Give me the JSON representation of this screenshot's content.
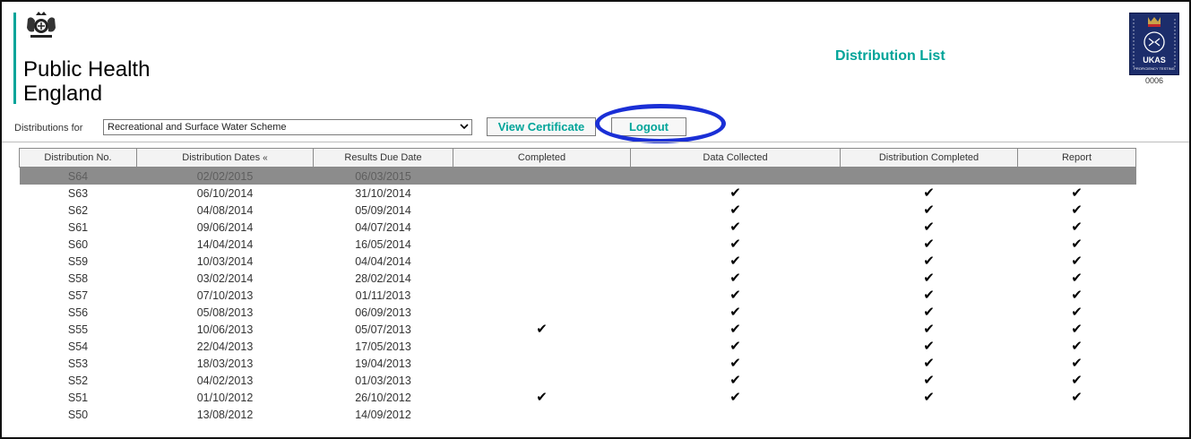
{
  "header": {
    "org_line1": "Public Health",
    "org_line2": "England",
    "page_title": "Distribution List",
    "ukas_label": "UKAS",
    "ukas_sub": "PROFICIENCY TESTING",
    "ukas_number": "0006"
  },
  "toolbar": {
    "distributions_label": "Distributions for",
    "scheme_selected": "Recreational and Surface Water Scheme",
    "view_certificate_label": "View Certificate",
    "logout_label": "Logout"
  },
  "table": {
    "headers": {
      "dist_no": "Distribution No.",
      "dist_dates": "Distribution Dates",
      "sort_indicator": "«",
      "results_due": "Results Due Date",
      "completed": "Completed",
      "data_collected": "Data Collected",
      "dist_completed": "Distribution Completed",
      "report": "Report"
    },
    "check_glyph": "✔",
    "rows": [
      {
        "no": "S64",
        "dates": "02/02/2015",
        "due": "06/03/2015",
        "completed": false,
        "collected": false,
        "dist_completed": false,
        "report": false,
        "selected": true
      },
      {
        "no": "S63",
        "dates": "06/10/2014",
        "due": "31/10/2014",
        "completed": false,
        "collected": true,
        "dist_completed": true,
        "report": true
      },
      {
        "no": "S62",
        "dates": "04/08/2014",
        "due": "05/09/2014",
        "completed": false,
        "collected": true,
        "dist_completed": true,
        "report": true
      },
      {
        "no": "S61",
        "dates": "09/06/2014",
        "due": "04/07/2014",
        "completed": false,
        "collected": true,
        "dist_completed": true,
        "report": true
      },
      {
        "no": "S60",
        "dates": "14/04/2014",
        "due": "16/05/2014",
        "completed": false,
        "collected": true,
        "dist_completed": true,
        "report": true
      },
      {
        "no": "S59",
        "dates": "10/03/2014",
        "due": "04/04/2014",
        "completed": false,
        "collected": true,
        "dist_completed": true,
        "report": true
      },
      {
        "no": "S58",
        "dates": "03/02/2014",
        "due": "28/02/2014",
        "completed": false,
        "collected": true,
        "dist_completed": true,
        "report": true
      },
      {
        "no": "S57",
        "dates": "07/10/2013",
        "due": "01/11/2013",
        "completed": false,
        "collected": true,
        "dist_completed": true,
        "report": true
      },
      {
        "no": "S56",
        "dates": "05/08/2013",
        "due": "06/09/2013",
        "completed": false,
        "collected": true,
        "dist_completed": true,
        "report": true
      },
      {
        "no": "S55",
        "dates": "10/06/2013",
        "due": "05/07/2013",
        "completed": true,
        "collected": true,
        "dist_completed": true,
        "report": true
      },
      {
        "no": "S54",
        "dates": "22/04/2013",
        "due": "17/05/2013",
        "completed": false,
        "collected": true,
        "dist_completed": true,
        "report": true
      },
      {
        "no": "S53",
        "dates": "18/03/2013",
        "due": "19/04/2013",
        "completed": false,
        "collected": true,
        "dist_completed": true,
        "report": true
      },
      {
        "no": "S52",
        "dates": "04/02/2013",
        "due": "01/03/2013",
        "completed": false,
        "collected": true,
        "dist_completed": true,
        "report": true
      },
      {
        "no": "S51",
        "dates": "01/10/2012",
        "due": "26/10/2012",
        "completed": true,
        "collected": true,
        "dist_completed": true,
        "report": true
      },
      {
        "no": "S50",
        "dates": "13/08/2012",
        "due": "14/09/2012",
        "completed": false,
        "collected": false,
        "dist_completed": false,
        "report": false
      }
    ]
  },
  "colors": {
    "brand_teal": "#00a499",
    "selected_row": "#8c8c8c",
    "highlight_ring": "#1a2fd6",
    "ukas_blue": "#1c2d6b"
  },
  "icons": {
    "crest": "royal-coat-of-arms-icon",
    "ukas": "ukas-crown-badge-icon",
    "dropdown": "chevron-down-icon",
    "check": "check-icon"
  }
}
